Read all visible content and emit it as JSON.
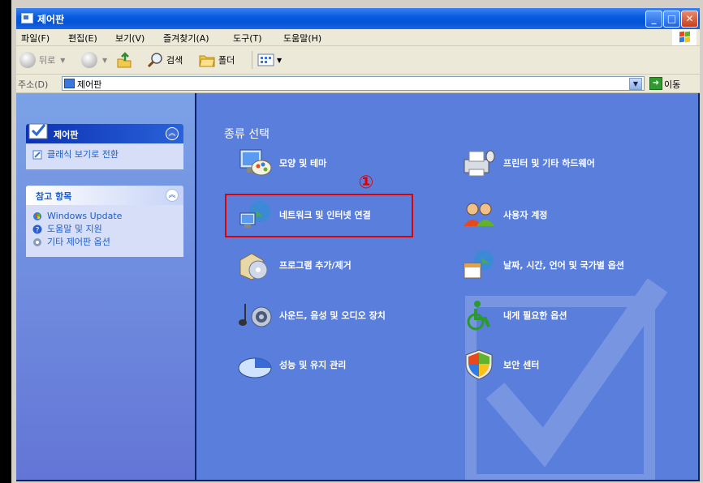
{
  "window": {
    "title": "제어판"
  },
  "menu": [
    "파일(F)",
    "편집(E)",
    "보기(V)",
    "즐겨찾기(A)",
    "도구(T)",
    "도움말(H)"
  ],
  "toolbar": {
    "back": "뒤로",
    "search": "검색",
    "folders": "폴더"
  },
  "address": {
    "label": "주소(D)",
    "value": "제어판",
    "go": "이동"
  },
  "sidebar": {
    "control_panel": {
      "title": "제어판",
      "link": "클래식 보기로 전환"
    },
    "see_also": {
      "title": "참고 항목",
      "links": [
        "Windows Update",
        "도움말 및 지원",
        "기타 제어판 옵션"
      ]
    }
  },
  "main": {
    "heading": "종류 선택",
    "annotation_number": "①",
    "categories": [
      "모양 및 테마",
      "프린터 및 기타 하드웨어",
      "네트워크 및 인터넷 연결",
      "사용자 계정",
      "프로그램 추가/제거",
      "날짜, 시간, 언어 및 국가별 옵션",
      "사운드, 음성 및 오디오 장치",
      "내게 필요한 옵션",
      "성능 및 유지 관리",
      "보안 센터"
    ]
  }
}
